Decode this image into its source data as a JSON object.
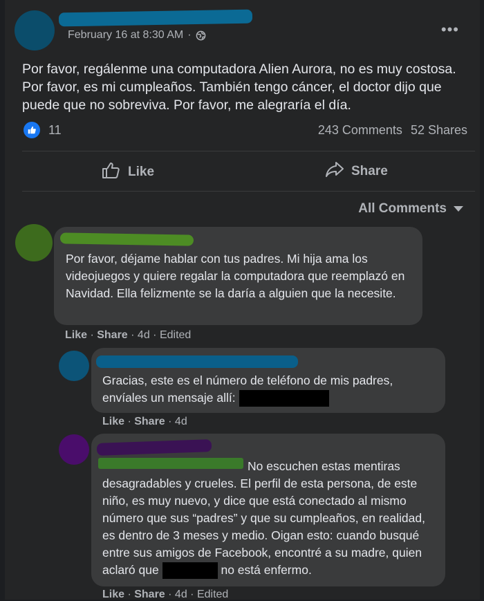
{
  "post": {
    "timestamp": "February 16 at 8:30 AM",
    "separator": "·",
    "text": "Por favor, regálenme una computadora Alien Aurora, no es muy costosa. Por favor, es mi cumpleaños. También tengo cáncer, el doctor dijo que puede que no sobreviva. Por favor, me alegraría el día.",
    "reaction_count": "11",
    "comments_count": "243 Comments",
    "shares_count": "52 Shares",
    "more_icon": "more-horizontal-icon",
    "privacy_icon": "globe-icon"
  },
  "actions": {
    "like": "Like",
    "share": "Share"
  },
  "filter": {
    "label": "All Comments"
  },
  "comments": [
    {
      "text": "Por favor, déjame hablar con tus padres. Mi hija ama los videojuegos y quiere regalar la computadora que reemplazó en Navidad. Ella felizmente se la daría a alguien que la necesite.",
      "like": "Like",
      "share": "Share",
      "time": "4d",
      "edited": "Edited",
      "colors": {
        "avatar": "#3d6b1d",
        "name": "#4d8c24"
      }
    },
    {
      "text": "Gracias, este es el número de teléfono de mis padres, envíales un mensaje allí:",
      "like": "Like",
      "share": "Share",
      "time": "4d",
      "colors": {
        "avatar": "#0c5478",
        "name": "#0a5f8a"
      }
    },
    {
      "text_part1": "No escuchen estas mentiras desagradables y crueles. El perfil de esta persona, de este niño, es muy nuevo, y dice que está conectado al mismo número que sus “padres” y que su cumpleaños, en realidad, es dentro de 3 meses y medio. Oigan esto: cuando busqué entre sus amigos de Facebook, encontré a su madre, quien aclaró que",
      "text_part2": "no está enfermo.",
      "like": "Like",
      "share": "Share",
      "time": "4d",
      "edited": "Edited",
      "colors": {
        "avatar": "#4a0d6b",
        "name": "#3a1254",
        "tag": "#3a7a2a"
      }
    }
  ],
  "colors": {
    "post_avatar": "#0b4d6b",
    "post_name": "#0b6a95",
    "like_blue": "#1877f2"
  }
}
